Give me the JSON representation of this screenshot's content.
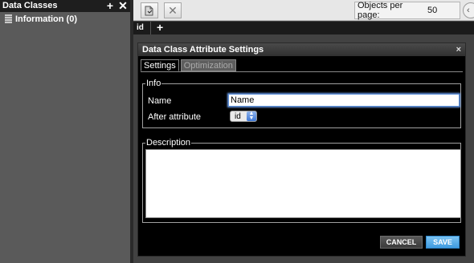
{
  "sidebar": {
    "title": "Data Classes",
    "add_icon": "plus-icon",
    "close_icon": "close-icon",
    "items": [
      {
        "label": "Information (0)",
        "icon": "database-icon"
      }
    ]
  },
  "toolbar": {
    "new_icon": "new-document-icon",
    "delete_icon": "delete-x-icon",
    "objects_per_page_label": "Objects per page:",
    "objects_per_page_value": "50",
    "nav_icon": "prev-page-icon"
  },
  "columns": {
    "first_label": "id",
    "add_icon": "plus-icon"
  },
  "dialog": {
    "title": "Data Class Attribute Settings",
    "close_glyph": "×",
    "tabs": [
      {
        "label": "Settings",
        "active": true
      },
      {
        "label": "Optimization",
        "active": false
      }
    ],
    "info_legend": "Info",
    "name_label": "Name",
    "name_value": "Name",
    "after_attribute_label": "After attribute",
    "after_attribute_value": "id",
    "description_legend": "Description",
    "description_value": "",
    "cancel_label": "CANCEL",
    "save_label": "SAVE"
  },
  "colors": {
    "sidebar_bg": "#5a5a5a",
    "header_bg": "#1e1e1e",
    "dialog_bg": "#000000",
    "save_accent": "#4aa6e8"
  }
}
